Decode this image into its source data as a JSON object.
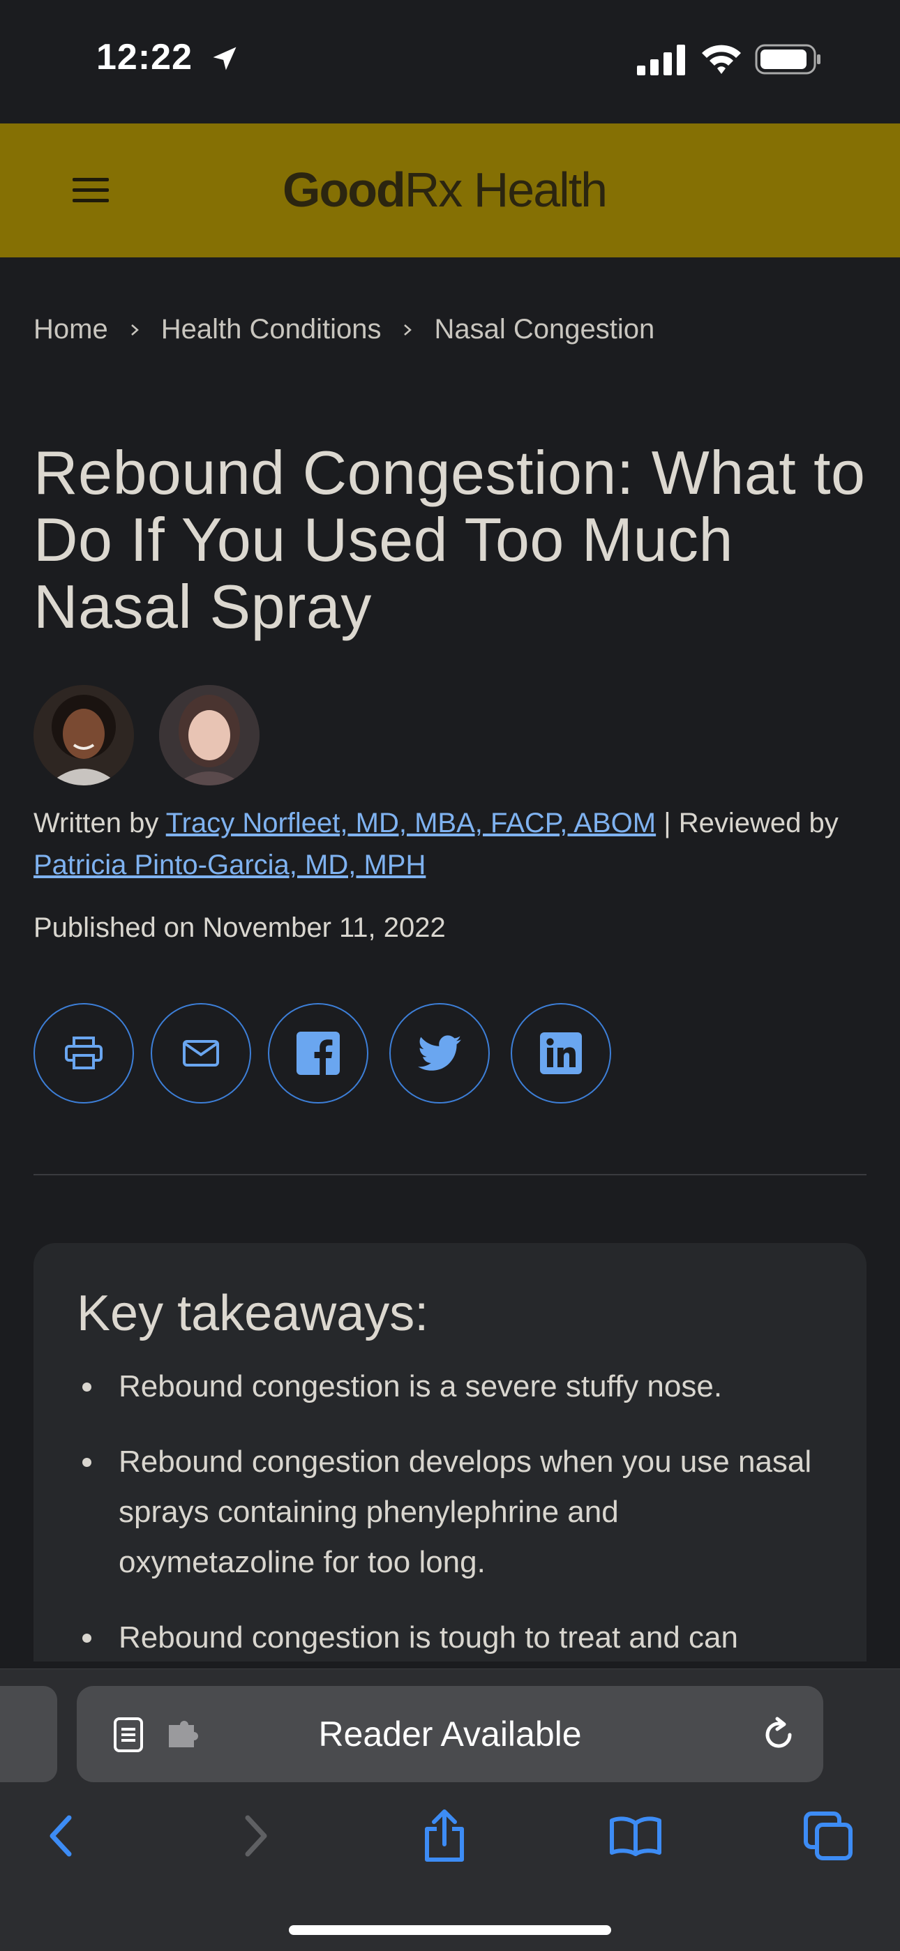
{
  "status_bar": {
    "time": "12:22"
  },
  "header": {
    "logo_bold": "Good",
    "logo_light": "Rx Health"
  },
  "breadcrumb": [
    "Home",
    "Health Conditions",
    "Nasal Congestion"
  ],
  "article": {
    "title": "Rebound Congestion: What to Do If You Used Too Much Nasal Spray",
    "written_by_prefix": "Written by",
    "author": "Tracy Norfleet, MD, MBA, FACP, ABOM",
    "reviewed_by_prefix": " | Reviewed by",
    "reviewer": "Patricia Pinto-Garcia, MD, MPH",
    "published": "Published on November 11, 2022"
  },
  "share_buttons": [
    "print-icon",
    "email-icon",
    "facebook-icon",
    "twitter-icon",
    "linkedin-icon"
  ],
  "takeaways": {
    "heading": "Key takeaways:",
    "items": [
      "Rebound congestion is a severe stuffy nose.",
      "Rebound congestion develops when you use nasal sprays containing phenylephrine and oxymetazoline for too long.",
      "Rebound congestion is tough to treat and can"
    ]
  },
  "browser": {
    "address_label": "Reader Available"
  },
  "colors": {
    "header_bg": "#857004",
    "link": "#7fb2f0",
    "accent_blue": "#3d7fd8",
    "page_bg": "#1b1c1f"
  }
}
